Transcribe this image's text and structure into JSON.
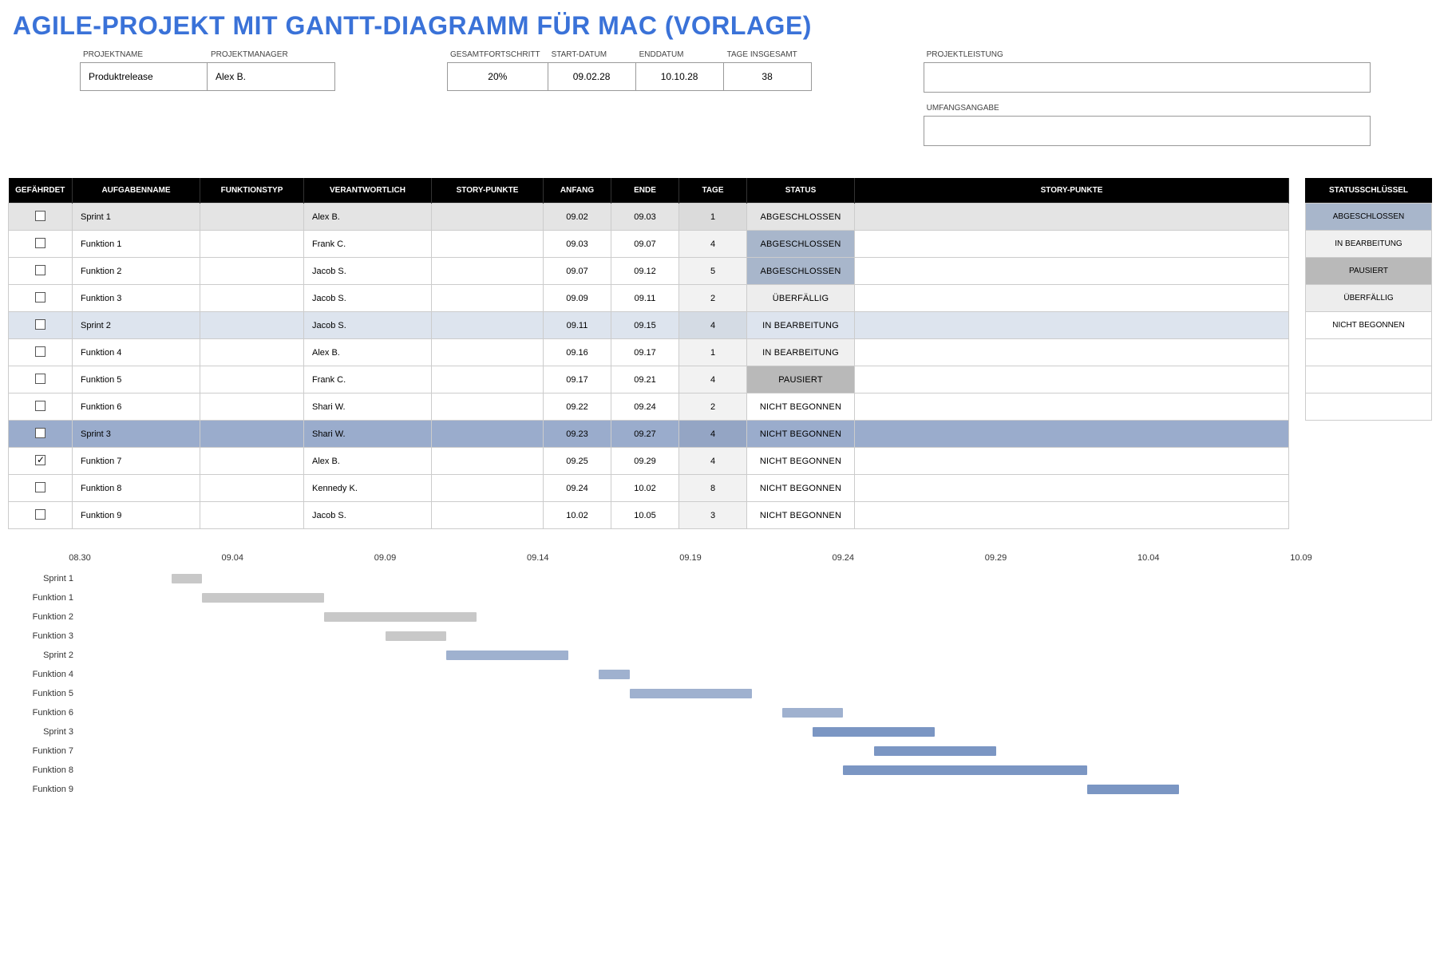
{
  "title": "AGILE-PROJEKT MIT GANTT-DIAGRAMM FÜR MAC (VORLAGE)",
  "meta": {
    "projectname_label": "PROJEKTNAME",
    "projectname": "Produktrelease",
    "manager_label": "PROJEKTMANAGER",
    "manager": "Alex B.",
    "progress_label": "GESAMTFORTSCHRITT",
    "progress": "20%",
    "start_label": "START-DATUM",
    "start": "09.02.28",
    "end_label": "ENDDATUM",
    "end": "10.10.28",
    "days_label": "TAGE INSGESAMT",
    "days": "38",
    "performance_label": "PROJEKTLEISTUNG",
    "performance": "",
    "scope_label": "UMFANGSANGABE",
    "scope": ""
  },
  "columns": {
    "risk": "GEFÄHRDET",
    "task": "AUFGABENNAME",
    "func": "FUNKTIONSTYP",
    "resp": "VERANTWORTLICH",
    "pts": "STORY-PUNKTE",
    "start": "ANFANG",
    "end": "ENDE",
    "days": "TAGE",
    "status": "STATUS",
    "story": "STORY-PUNKTE"
  },
  "tasks": [
    {
      "name": "Sprint 1",
      "resp": "Alex B.",
      "start": "09.02",
      "end": "09.03",
      "days": "1",
      "status": "ABGESCHLOSSEN",
      "statusClass": "status-abgeschlossen",
      "rowClass": "row-sprint1",
      "risk": false
    },
    {
      "name": "Funktion 1",
      "resp": "Frank C.",
      "start": "09.03",
      "end": "09.07",
      "days": "4",
      "status": "ABGESCHLOSSEN",
      "statusClass": "status-abgeschlossen",
      "rowClass": "",
      "risk": false
    },
    {
      "name": "Funktion 2",
      "resp": "Jacob S.",
      "start": "09.07",
      "end": "09.12",
      "days": "5",
      "status": "ABGESCHLOSSEN",
      "statusClass": "status-abgeschlossen",
      "rowClass": "",
      "risk": false
    },
    {
      "name": "Funktion 3",
      "resp": "Jacob S.",
      "start": "09.09",
      "end": "09.11",
      "days": "2",
      "status": "ÜBERFÄLLIG",
      "statusClass": "status-ueberfaellig",
      "rowClass": "",
      "risk": false
    },
    {
      "name": "Sprint 2",
      "resp": "Jacob S.",
      "start": "09.11",
      "end": "09.15",
      "days": "4",
      "status": "IN BEARBEITUNG",
      "statusClass": "status-inbearbeitung",
      "rowClass": "row-sprint2",
      "risk": false
    },
    {
      "name": "Funktion 4",
      "resp": "Alex B.",
      "start": "09.16",
      "end": "09.17",
      "days": "1",
      "status": "IN BEARBEITUNG",
      "statusClass": "status-inbearbeitung",
      "rowClass": "",
      "risk": false
    },
    {
      "name": "Funktion 5",
      "resp": "Frank C.",
      "start": "09.17",
      "end": "09.21",
      "days": "4",
      "status": "PAUSIERT",
      "statusClass": "status-pausiert",
      "rowClass": "",
      "risk": false
    },
    {
      "name": "Funktion 6",
      "resp": "Shari W.",
      "start": "09.22",
      "end": "09.24",
      "days": "2",
      "status": "NICHT BEGONNEN",
      "statusClass": "status-nichtbegonnen",
      "rowClass": "",
      "risk": false
    },
    {
      "name": "Sprint 3",
      "resp": "Shari W.",
      "start": "09.23",
      "end": "09.27",
      "days": "4",
      "status": "NICHT BEGONNEN",
      "statusClass": "status-nichtbegonnen",
      "rowClass": "row-sprint3",
      "risk": false
    },
    {
      "name": "Funktion 7",
      "resp": "Alex B.",
      "start": "09.25",
      "end": "09.29",
      "days": "4",
      "status": "NICHT BEGONNEN",
      "statusClass": "status-nichtbegonnen",
      "rowClass": "",
      "risk": true
    },
    {
      "name": "Funktion 8",
      "resp": "Kennedy K.",
      "start": "09.24",
      "end": "10.02",
      "days": "8",
      "status": "NICHT BEGONNEN",
      "statusClass": "status-nichtbegonnen",
      "rowClass": "",
      "risk": false
    },
    {
      "name": "Funktion 9",
      "resp": "Jacob S.",
      "start": "10.02",
      "end": "10.05",
      "days": "3",
      "status": "NICHT BEGONNEN",
      "statusClass": "status-nichtbegonnen",
      "rowClass": "",
      "risk": false
    }
  ],
  "statusKey": {
    "header": "STATUSSCHLÜSSEL",
    "items": [
      {
        "label": "ABGESCHLOSSEN",
        "class": "status-abgeschlossen"
      },
      {
        "label": "IN BEARBEITUNG",
        "class": "status-inbearbeitung"
      },
      {
        "label": "PAUSIERT",
        "class": "status-pausiert"
      },
      {
        "label": "ÜBERFÄLLIG",
        "class": "status-ueberfaellig"
      },
      {
        "label": "NICHT BEGONNEN",
        "class": "status-nichtbegonnen"
      },
      {
        "label": "",
        "class": ""
      },
      {
        "label": "",
        "class": ""
      },
      {
        "label": "",
        "class": ""
      }
    ]
  },
  "chart_data": {
    "type": "bar",
    "title": "",
    "x_ticks": [
      "08.30",
      "09.04",
      "09.09",
      "09.14",
      "09.19",
      "09.24",
      "09.29",
      "10.04",
      "10.09"
    ],
    "x_range_days": {
      "start": 0,
      "end": 40
    },
    "categories": [
      "Sprint 1",
      "Funktion 1",
      "Funktion 2",
      "Funktion 3",
      "Sprint 2",
      "Funktion 4",
      "Funktion 5",
      "Funktion 6",
      "Sprint 3",
      "Funktion 7",
      "Funktion 8",
      "Funktion 9"
    ],
    "bars": [
      {
        "label": "Sprint 1",
        "start": 3,
        "duration": 1,
        "style": "light"
      },
      {
        "label": "Funktion 1",
        "start": 4,
        "duration": 4,
        "style": "light"
      },
      {
        "label": "Funktion 2",
        "start": 8,
        "duration": 5,
        "style": "light"
      },
      {
        "label": "Funktion 3",
        "start": 10,
        "duration": 2,
        "style": "light"
      },
      {
        "label": "Sprint 2",
        "start": 12,
        "duration": 4,
        "style": "mid"
      },
      {
        "label": "Funktion 4",
        "start": 17,
        "duration": 1,
        "style": "mid"
      },
      {
        "label": "Funktion 5",
        "start": 18,
        "duration": 4,
        "style": "mid"
      },
      {
        "label": "Funktion 6",
        "start": 23,
        "duration": 2,
        "style": "mid"
      },
      {
        "label": "Sprint 3",
        "start": 24,
        "duration": 4,
        "style": "blue"
      },
      {
        "label": "Funktion 7",
        "start": 26,
        "duration": 4,
        "style": "blue"
      },
      {
        "label": "Funktion 8",
        "start": 25,
        "duration": 8,
        "style": "blue"
      },
      {
        "label": "Funktion 9",
        "start": 33,
        "duration": 3,
        "style": "blue"
      }
    ]
  }
}
